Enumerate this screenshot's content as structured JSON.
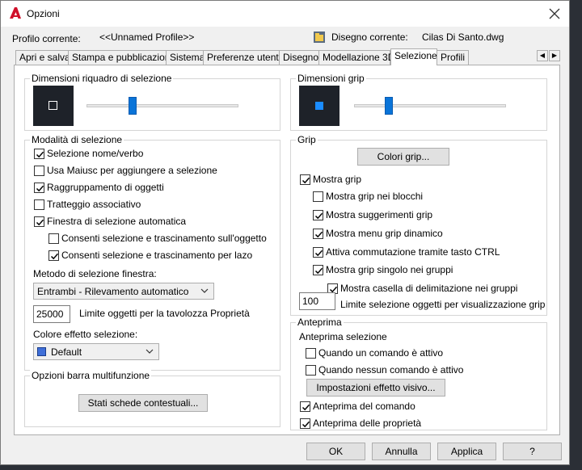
{
  "window": {
    "title": "Opzioni"
  },
  "profile": {
    "label": "Profilo corrente:",
    "value": "<<Unnamed Profile>>"
  },
  "drawing": {
    "label": "Disegno corrente:",
    "value": "Cilas Di Santo.dwg"
  },
  "tabs": [
    {
      "label": "Apri e salva"
    },
    {
      "label": "Stampa e pubblicazione"
    },
    {
      "label": "Sistema"
    },
    {
      "label": "Preferenze utente"
    },
    {
      "label": "Disegno"
    },
    {
      "label": "Modellazione 3D"
    },
    {
      "label": "Selezione",
      "active": true
    },
    {
      "label": "Profili"
    }
  ],
  "pickbox": {
    "title": "Dimensioni riquadro di selezione",
    "level": 0.33
  },
  "grip_size": {
    "title": "Dimensioni grip",
    "level": 0.22
  },
  "selection_modes": {
    "title": "Modalità di selezione",
    "items": [
      {
        "label": "Selezione nome/verbo",
        "checked": true
      },
      {
        "label": "Usa Maiusc per aggiungere a selezione",
        "checked": false
      },
      {
        "label": "Raggruppamento di oggetti",
        "checked": true
      },
      {
        "label": "Tratteggio associativo",
        "checked": false
      },
      {
        "label": "Finestra di selezione automatica",
        "checked": true
      },
      {
        "label": "Consenti selezione e trascinamento sull'oggetto",
        "checked": false
      },
      {
        "label": "Consenti selezione e trascinamento per lazo",
        "checked": true
      }
    ],
    "window_method_label": "Metodo di selezione finestra:",
    "window_method_value": "Entrambi - Rilevamento automatico",
    "limit_value": "25000",
    "limit_label": "Limite oggetti per la tavolozza Proprietà",
    "effect_color_label": "Colore effetto selezione:",
    "effect_color_value": "Default",
    "effect_color_hex": "#3f6fd8"
  },
  "ribbon": {
    "title": "Opzioni barra multifunzione",
    "button": "Stati schede contestuali..."
  },
  "grip": {
    "title": "Grip",
    "colors_button": "Colori grip...",
    "items": [
      {
        "label": "Mostra grip",
        "checked": true
      },
      {
        "label": "Mostra grip nei blocchi",
        "checked": false
      },
      {
        "label": "Mostra suggerimenti grip",
        "checked": true
      },
      {
        "label": "Mostra menu grip dinamico",
        "checked": true
      },
      {
        "label": "Attiva commutazione tramite tasto CTRL",
        "checked": true
      },
      {
        "label": "Mostra grip singolo nei gruppi",
        "checked": true
      },
      {
        "label": "Mostra casella di delimitazione nei gruppi",
        "checked": true
      }
    ],
    "limit_value": "100",
    "limit_label": "Limite selezione oggetti per visualizzazione grip"
  },
  "preview": {
    "title": "Anteprima",
    "sub_label": "Anteprima selezione",
    "items": [
      {
        "label": "Quando un comando è attivo",
        "checked": false
      },
      {
        "label": "Quando nessun comando è attivo",
        "checked": false
      }
    ],
    "effects_button": "Impostazioni effetto visivo...",
    "items2": [
      {
        "label": "Anteprima del comando",
        "checked": true
      },
      {
        "label": "Anteprima delle proprietà",
        "checked": true
      }
    ]
  },
  "footer": {
    "ok": "OK",
    "cancel": "Annulla",
    "apply": "Applica",
    "help": "?"
  }
}
